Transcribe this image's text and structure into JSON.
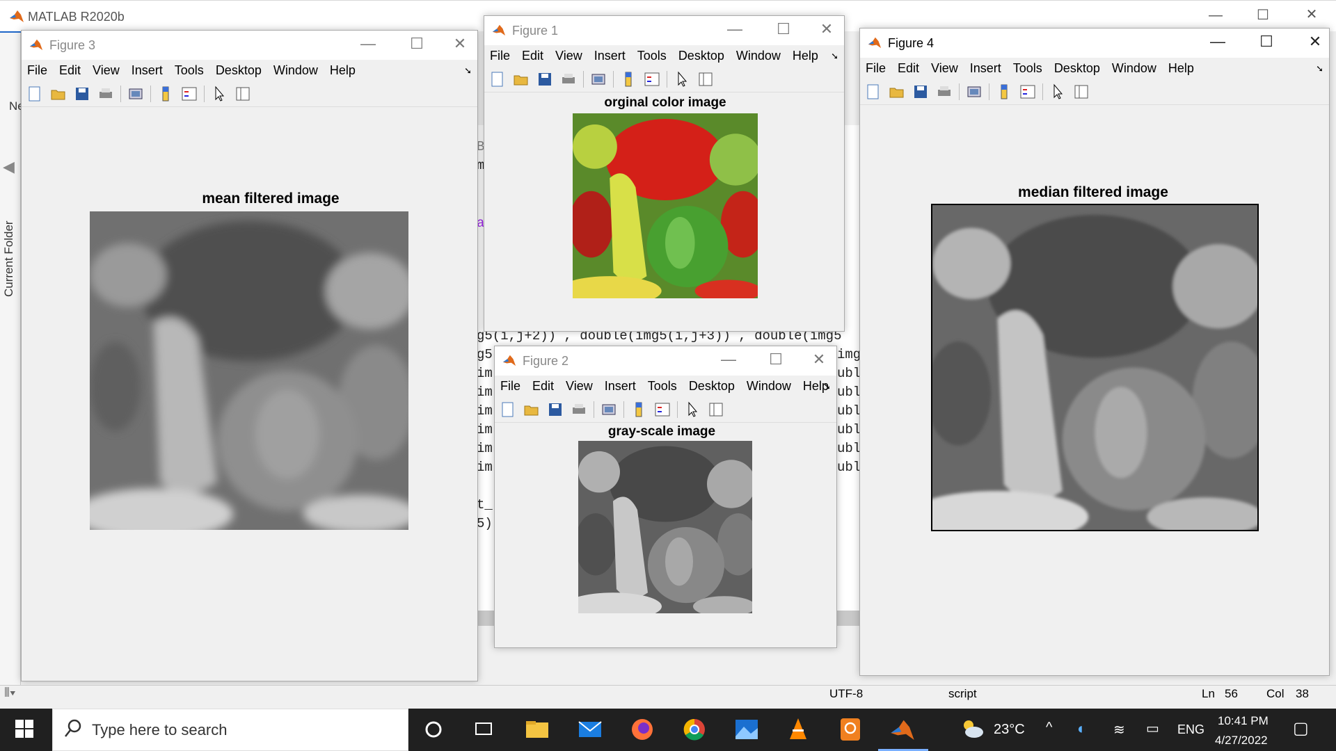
{
  "app": {
    "title": "MATLAB R2020b"
  },
  "sidebar": {
    "current_folder": "Current Folder",
    "ne_label": "Ne"
  },
  "editor": {
    "lines": [
      "g5(i,j+2)) , double(img5(i,j+3)) , double(img5",
      "g5",
      "im",
      "im",
      "im",
      "im",
      "im",
      "im",
      "t_",
      "5)"
    ],
    "right_col": [
      "img5",
      "ubl",
      "ubl",
      "ubl",
      "ubl",
      "ubl",
      "ubl"
    ],
    "fragment_b": "B",
    "fragment_m": "m",
    "fragment_a": "a"
  },
  "figures": {
    "fig3": {
      "title": "Figure 3",
      "plot_title": "mean filtered image"
    },
    "fig1": {
      "title": "Figure 1",
      "plot_title": "orginal color image"
    },
    "fig2": {
      "title": "Figure 2",
      "plot_title": "gray-scale image"
    },
    "fig4": {
      "title": "Figure 4",
      "plot_title": "median filtered image"
    }
  },
  "menu": [
    "File",
    "Edit",
    "View",
    "Insert",
    "Tools",
    "Desktop",
    "Window",
    "Help"
  ],
  "statusbar": {
    "encoding": "UTF-8",
    "type": "script",
    "ln_label": "Ln",
    "ln": "56",
    "col_label": "Col",
    "col": "38"
  },
  "taskbar": {
    "search_placeholder": "Type here to search",
    "temperature": "23°C",
    "language": "ENG",
    "time": "10:41 PM",
    "date": "4/27/2022"
  },
  "colors": {
    "accent": "#1e66c8",
    "taskbar": "#202020"
  }
}
